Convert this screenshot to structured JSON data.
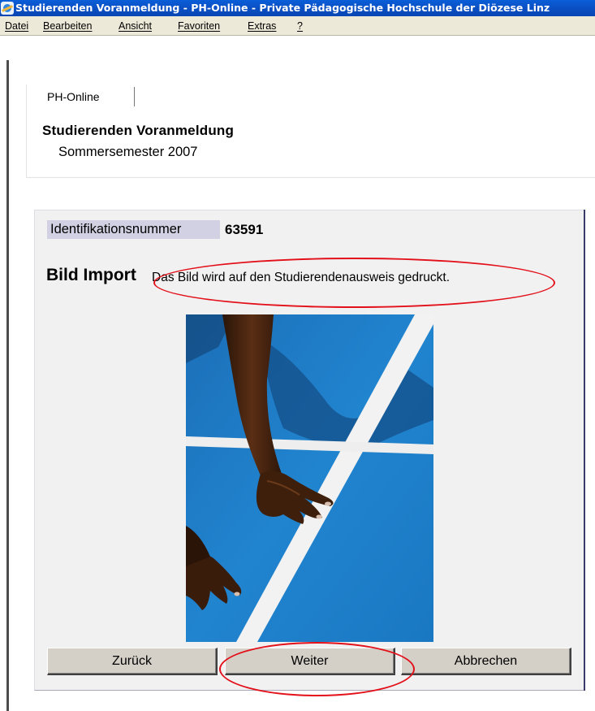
{
  "window": {
    "title": "Studierenden Voranmeldung - PH-Online - Private Pädagogische Hochschule der Diözese Linz"
  },
  "menubar": {
    "items": [
      "Datei",
      "Bearbeiten",
      "Ansicht",
      "Favoriten",
      "Extras",
      "?"
    ]
  },
  "header": {
    "tab_label": "PH-Online",
    "page_title": "Studierenden Voranmeldung",
    "semester": "Sommersemester 2007"
  },
  "identification": {
    "label": "Identifikationsnummer",
    "value": "63591"
  },
  "image_import": {
    "heading": "Bild Import",
    "hint": "Das Bild wird auf den Studierendenausweis gedruckt."
  },
  "buttons": {
    "back": "Zurück",
    "next": "Weiter",
    "cancel": "Abbrechen"
  },
  "colors": {
    "titlebar": "#0a4fc4",
    "annotation": "#e3101a",
    "track": "#1f7fc8",
    "panel": "#f1f1f2",
    "id_highlight": "#d1d1e3"
  },
  "icons": {
    "app": "internet-explorer-icon"
  }
}
